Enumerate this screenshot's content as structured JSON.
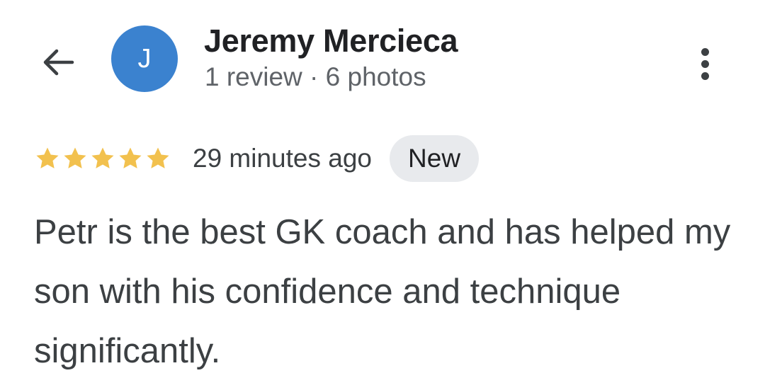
{
  "header": {
    "back_icon": "arrow-back-icon",
    "avatar_initial": "J",
    "avatar_color": "#3b82cf",
    "reviewer_name": "Jeremy Mercieca",
    "reviewer_meta": "1 review · 6 photos",
    "more_icon": "more-vert-icon"
  },
  "review": {
    "rating": 5,
    "rating_max": 5,
    "star_color": "#f2c14e",
    "timestamp": "29 minutes ago",
    "badge": "New",
    "text": "Petr is the best GK coach and has helped my son with his confidence and technique significantly."
  }
}
